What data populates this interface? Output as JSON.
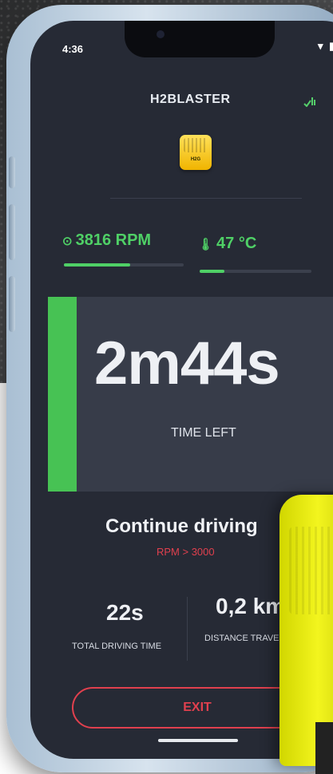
{
  "status_bar": {
    "time": "4:36",
    "icons": "▾ ▮"
  },
  "app": {
    "title": "H2BLASTER",
    "corner_icon": "signal-check-icon"
  },
  "device": {
    "label": "H2G"
  },
  "metrics": {
    "rpm_text": "3816 RPM",
    "rpm_icon": "gauge-icon",
    "rpm_level": 0.55,
    "temp_text": "47 °C",
    "temp_icon": "thermometer-icon",
    "temp_level": 0.22
  },
  "timer": {
    "value": "2m44s",
    "label": "TIME LEFT"
  },
  "instruction": {
    "title": "Continue driving",
    "condition": "RPM > 3000"
  },
  "stats": {
    "driving_time_value": "22s",
    "driving_time_label": "TOTAL DRIVING TIME",
    "distance_value": "0,2 km",
    "distance_label": "DISTANCE TRAVELL"
  },
  "actions": {
    "exit_label": "EXIT"
  },
  "colors": {
    "accent_green": "#4fd066",
    "accent_red": "#e0404e",
    "screen_bg": "#262a35",
    "panel_bg": "#373c49"
  }
}
